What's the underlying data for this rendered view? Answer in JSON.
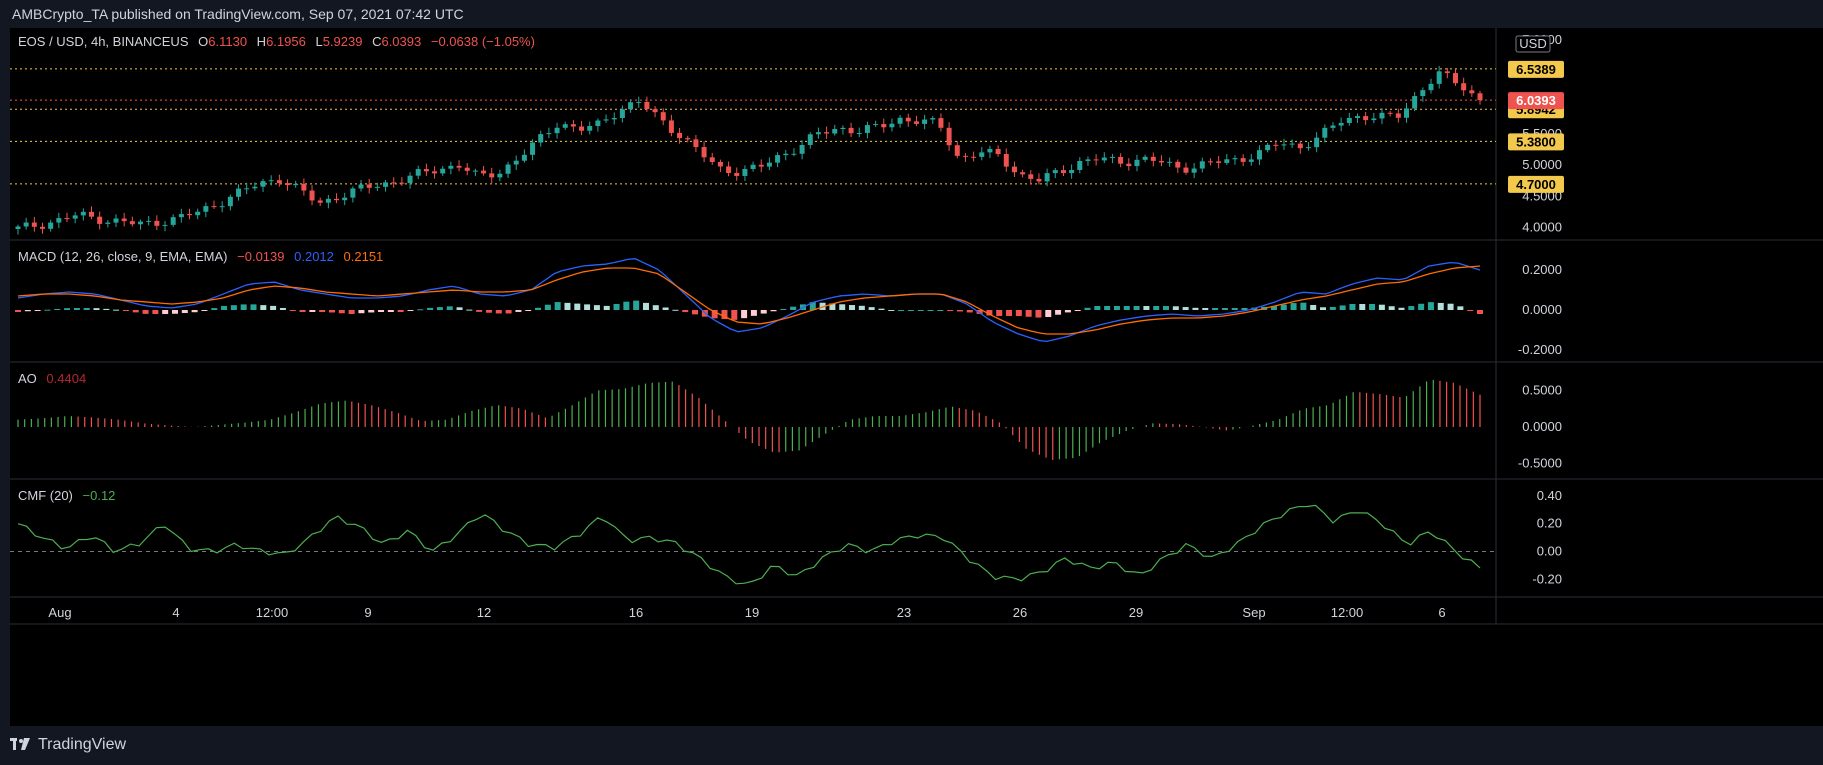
{
  "header": {
    "publisher": "AMBCrypto_TA published on TradingView.com, Sep 07, 2021 07:42 UTC"
  },
  "price_legend": {
    "symbol": "EOS / USD, 4h, BINANCEUS",
    "o_label": "O",
    "o_value": "6.1130",
    "h_label": "H",
    "h_value": "6.1956",
    "l_label": "L",
    "l_value": "5.9239",
    "c_label": "C",
    "c_value": "6.0393",
    "change": "−0.0638 (−1.05%)"
  },
  "macd_legend": {
    "label": "MACD (12, 26, close, 9, EMA, EMA)",
    "hist": "−0.0139",
    "macd": "0.2012",
    "signal": "0.2151"
  },
  "ao_legend": {
    "label": "AO",
    "value": "0.4404"
  },
  "cmf_legend": {
    "label": "CMF (20)",
    "value": "−0.12"
  },
  "currency": "USD",
  "footer": {
    "brand": "TradingView"
  },
  "colors": {
    "bull": "#26a69a",
    "bear": "#ef5350",
    "macd": "#2962ff",
    "signal": "#ff6d00",
    "ao_up": "#4caf50",
    "ao_down": "#ef5350",
    "cmf": "#4caf50",
    "level": "#f2c94c"
  },
  "chart_data": [
    {
      "type": "candlestick",
      "title": "EOS / USD, 4h, BINANCEUS",
      "ylim": [
        3.9,
        7.0
      ],
      "y_ticks": [
        "7.0000",
        "6.5000",
        "6.0000",
        "5.5000",
        "5.0000",
        "4.5000",
        "4.0000"
      ],
      "x_ticks": [
        "Aug",
        "4",
        "12:00",
        "9",
        "12",
        "16",
        "19",
        "23",
        "26",
        "29",
        "Sep",
        "12:00",
        "6"
      ],
      "close_path": [
        3.98,
        4.05,
        4.12,
        4.2,
        4.15,
        4.1,
        4.05,
        4.1,
        4.15,
        4.25,
        4.4,
        4.55,
        4.7,
        4.8,
        4.6,
        4.4,
        4.5,
        4.6,
        4.7,
        4.75,
        4.85,
        4.95,
        5.0,
        4.8,
        4.9,
        5.1,
        5.4,
        5.7,
        5.55,
        5.65,
        5.9,
        6.0,
        5.75,
        5.5,
        5.2,
        4.95,
        4.9,
        4.95,
        5.15,
        5.3,
        5.5,
        5.6,
        5.55,
        5.6,
        5.75,
        5.7,
        5.65,
        5.1,
        5.2,
        5.15,
        4.85,
        4.75,
        4.9,
        5.05,
        5.1,
        5.05,
        5.1,
        5.05,
        4.95,
        5.0,
        5.05,
        5.1,
        5.2,
        5.35,
        5.3,
        5.45,
        5.7,
        5.8,
        5.75,
        5.8,
        6.2,
        6.45,
        6.3,
        6.04
      ],
      "levels": [
        "6.5389",
        "5.8942",
        "5.3800",
        "4.7000"
      ],
      "last_price": "6.0393",
      "hidden_ticks": [
        "5.5000"
      ]
    },
    {
      "type": "line",
      "title": "MACD (12, 26, close, 9, EMA, EMA)",
      "ylim": [
        -0.22,
        0.3
      ],
      "y_ticks": [
        "0.2000",
        "0.0000",
        "-0.2000"
      ],
      "series": [
        {
          "name": "MACD",
          "values": [
            0.06,
            0.08,
            0.09,
            0.08,
            0.05,
            0.02,
            0.01,
            0.03,
            0.08,
            0.13,
            0.14,
            0.1,
            0.08,
            0.06,
            0.06,
            0.07,
            0.1,
            0.12,
            0.08,
            0.07,
            0.1,
            0.19,
            0.22,
            0.23,
            0.26,
            0.2,
            0.08,
            -0.04,
            -0.11,
            -0.09,
            -0.03,
            0.04,
            0.07,
            0.08,
            0.07,
            0.08,
            0.08,
            0.03,
            -0.06,
            -0.12,
            -0.16,
            -0.13,
            -0.08,
            -0.05,
            -0.03,
            -0.02,
            -0.03,
            -0.02,
            0.0,
            0.04,
            0.09,
            0.08,
            0.13,
            0.16,
            0.15,
            0.22,
            0.24,
            0.2
          ]
        },
        {
          "name": "Signal",
          "values": [
            0.07,
            0.08,
            0.08,
            0.07,
            0.05,
            0.04,
            0.03,
            0.04,
            0.06,
            0.1,
            0.12,
            0.11,
            0.09,
            0.08,
            0.07,
            0.08,
            0.09,
            0.1,
            0.09,
            0.09,
            0.1,
            0.15,
            0.19,
            0.21,
            0.21,
            0.18,
            0.09,
            0.0,
            -0.06,
            -0.07,
            -0.04,
            0.0,
            0.04,
            0.06,
            0.07,
            0.08,
            0.08,
            0.04,
            -0.03,
            -0.09,
            -0.12,
            -0.12,
            -0.1,
            -0.07,
            -0.05,
            -0.04,
            -0.04,
            -0.03,
            -0.01,
            0.02,
            0.05,
            0.07,
            0.1,
            0.13,
            0.14,
            0.18,
            0.21,
            0.22
          ]
        }
      ]
    },
    {
      "type": "bar",
      "title": "AO",
      "ylim": [
        -0.6,
        0.75
      ],
      "y_ticks": [
        "0.5000",
        "0.0000",
        "-0.5000"
      ],
      "values": [
        0.1,
        0.12,
        0.15,
        0.13,
        0.1,
        0.05,
        0.02,
        0.0,
        0.03,
        0.06,
        0.1,
        0.2,
        0.32,
        0.36,
        0.3,
        0.2,
        0.08,
        0.1,
        0.22,
        0.3,
        0.25,
        0.12,
        0.3,
        0.5,
        0.52,
        0.6,
        0.62,
        0.4,
        0.1,
        -0.2,
        -0.35,
        -0.32,
        -0.1,
        0.1,
        0.15,
        0.15,
        0.2,
        0.28,
        0.22,
        0.05,
        -0.3,
        -0.45,
        -0.42,
        -0.2,
        -0.05,
        0.05,
        0.04,
        0.0,
        -0.05,
        0.02,
        0.1,
        0.25,
        0.3,
        0.48,
        0.45,
        0.4,
        0.65,
        0.6,
        0.44
      ]
    },
    {
      "type": "line",
      "title": "CMF (20)",
      "ylim": [
        -0.27,
        0.45
      ],
      "y_ticks": [
        "0.40",
        "0.20",
        "0.00",
        "-0.20"
      ],
      "values": [
        0.2,
        0.1,
        0.02,
        0.12,
        0.0,
        0.06,
        0.2,
        0.02,
        0.0,
        0.05,
        0.0,
        -0.02,
        0.1,
        0.25,
        0.18,
        0.05,
        0.15,
        0.0,
        0.12,
        0.28,
        0.15,
        0.05,
        0.03,
        0.12,
        0.26,
        0.08,
        0.1,
        0.06,
        -0.05,
        -0.18,
        -0.25,
        -0.1,
        -0.18,
        -0.05,
        0.05,
        0.0,
        0.08,
        0.12,
        0.1,
        -0.05,
        -0.18,
        -0.2,
        -0.15,
        -0.05,
        -0.12,
        -0.08,
        -0.18,
        -0.05,
        0.05,
        -0.05,
        0.05,
        0.18,
        0.28,
        0.35,
        0.22,
        0.3,
        0.2,
        0.05,
        0.15,
        0.0,
        -0.12
      ]
    }
  ]
}
